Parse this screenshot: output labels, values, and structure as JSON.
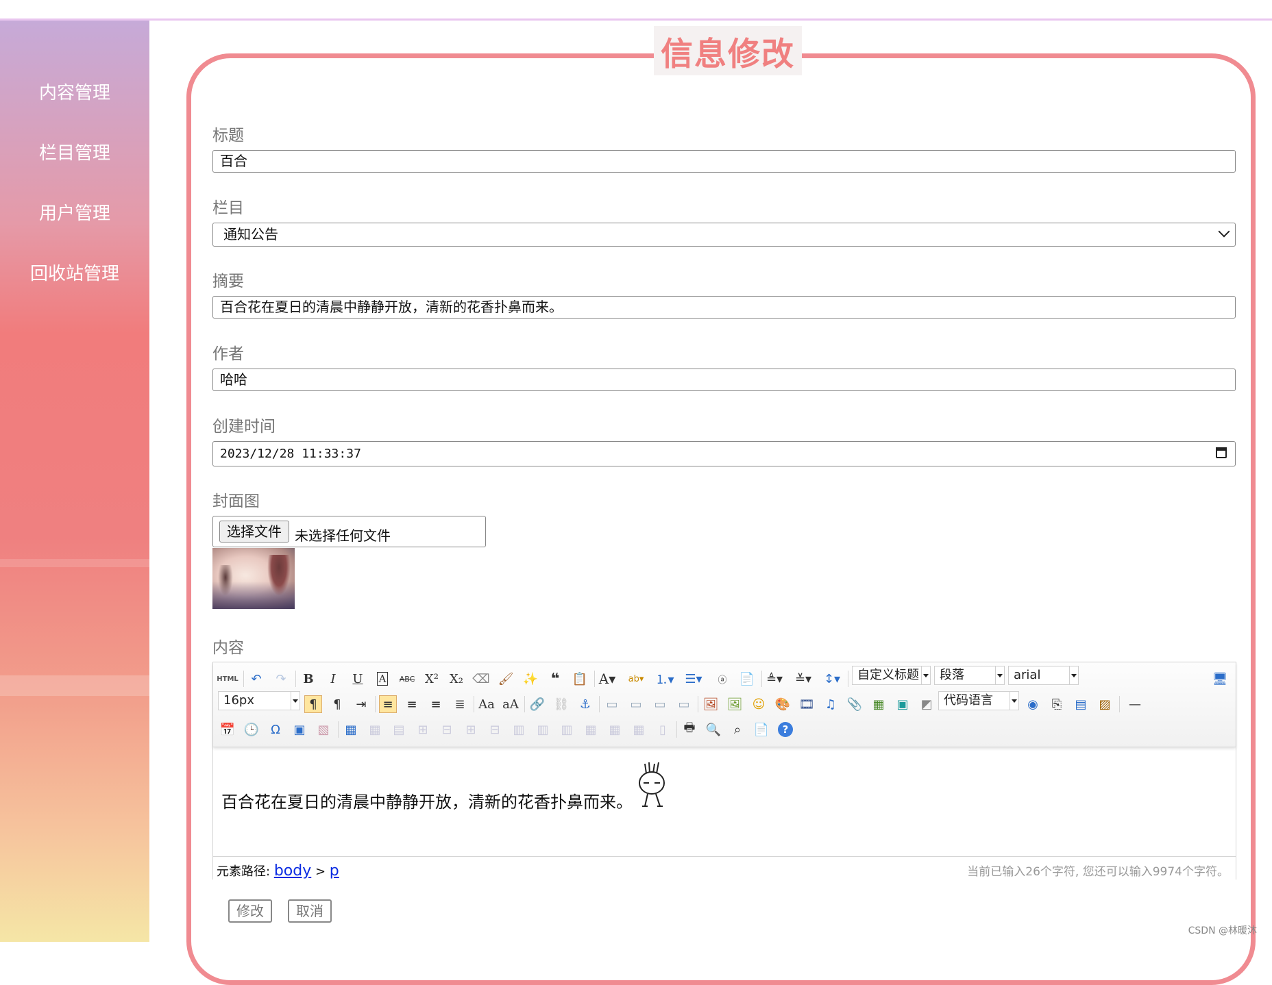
{
  "sidebar": {
    "items": [
      {
        "label": "内容管理"
      },
      {
        "label": "栏目管理"
      },
      {
        "label": "用户管理"
      },
      {
        "label": "回收站管理"
      }
    ]
  },
  "page": {
    "title": "信息修改"
  },
  "form": {
    "title_label": "标题",
    "title_value": "百合",
    "column_label": "栏目",
    "column_value": "通知公告",
    "summary_label": "摘要",
    "summary_value": "百合花在夏日的清晨中静静开放，清新的花香扑鼻而来。",
    "author_label": "作者",
    "author_value": "哈哈",
    "created_label": "创建时间",
    "created_value": "2023/12/28  11:33:37",
    "cover_label": "封面图",
    "file_button": "选择文件",
    "file_status": "未选择任何文件",
    "content_label": "内容"
  },
  "editor": {
    "custom_title": "自定义标题",
    "paragraph": "段落",
    "font_family": "arial",
    "font_size": "16px",
    "code_language": "代码语言",
    "body_text": "百合花在夏日的清晨中静静开放，清新的花香扑鼻而来。",
    "path_label": "元素路径:",
    "path_body": "body",
    "path_sep": ">",
    "path_p": "p",
    "word_count": "当前已输入26个字符, 您还可以输入9974个字符。"
  },
  "actions": {
    "submit": "修改",
    "cancel": "取消"
  },
  "watermark": "CSDN @林暖沐",
  "colors": {
    "accent": "#f08b91",
    "title": "#f08080",
    "sidebar_top": "#c6aad8",
    "sidebar_mid": "#f17c7c",
    "sidebar_bottom": "#f5e6a6"
  }
}
